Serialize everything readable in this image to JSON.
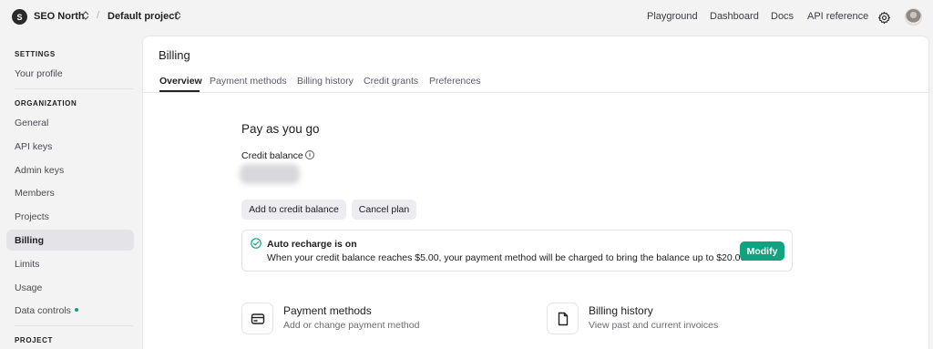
{
  "org": {
    "avatar_letter": "S",
    "name": "SEO North"
  },
  "breadcrumb_separator": "/",
  "project": {
    "name": "Default project"
  },
  "topnav": {
    "playground": "Playground",
    "dashboard": "Dashboard",
    "docs": "Docs",
    "api_reference": "API reference"
  },
  "sidebar": {
    "settings_heading": "SETTINGS",
    "your_profile": "Your profile",
    "organization_heading": "ORGANIZATION",
    "general": "General",
    "api_keys": "API keys",
    "admin_keys": "Admin keys",
    "members": "Members",
    "projects": "Projects",
    "billing": "Billing",
    "limits": "Limits",
    "usage": "Usage",
    "data_controls": "Data controls",
    "project_heading": "PROJECT"
  },
  "page": {
    "title": "Billing",
    "tabs": [
      "Overview",
      "Payment methods",
      "Billing history",
      "Credit grants",
      "Preferences"
    ],
    "active_tab": "Overview"
  },
  "overview": {
    "plan_title": "Pay as you go",
    "credit_balance_label": "Credit balance",
    "info_glyph": "i",
    "add_credit_button": "Add to credit balance",
    "cancel_plan_button": "Cancel plan",
    "auto_recharge": {
      "title": "Auto recharge is on",
      "description": "When your credit balance reaches $5.00, your payment method will be charged to bring the balance up to $20.00.",
      "modify_button": "Modify"
    },
    "cards": [
      {
        "title": "Payment methods",
        "description": "Add or change payment method",
        "icon": "credit-card-icon"
      },
      {
        "title": "Billing history",
        "description": "View past and current invoices",
        "icon": "document-icon"
      }
    ]
  },
  "colors": {
    "accent_green": "#10a37f",
    "active_sidebar_bg": "#e3e3e8",
    "button_bg": "#ececf1",
    "background": "#f3f3f4"
  }
}
